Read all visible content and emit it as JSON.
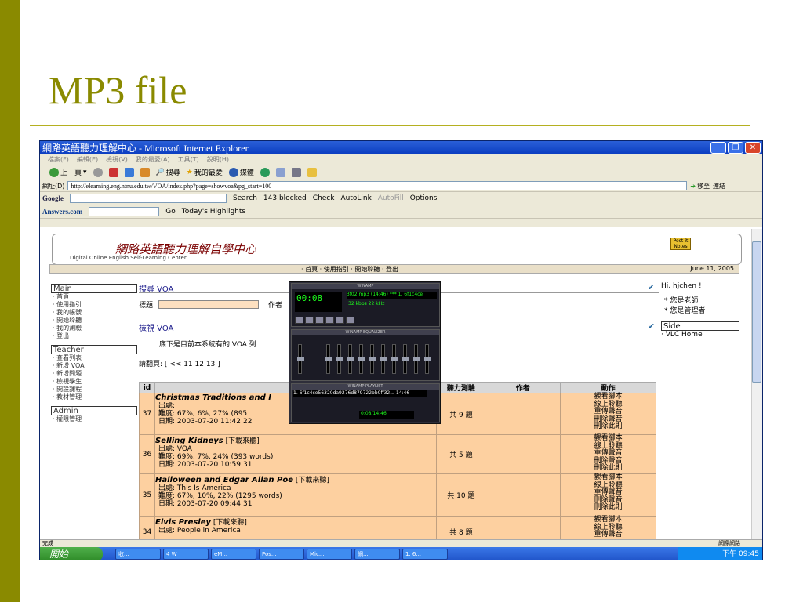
{
  "slide": {
    "title": "MP3 file"
  },
  "browser": {
    "title": "網路英語聽力理解中心 - Microsoft Internet Explorer",
    "menu": [
      "檔案(F)",
      "編輯(E)",
      "檢視(V)",
      "我的最愛(A)",
      "工具(T)",
      "說明(H)"
    ],
    "toolbar": {
      "back": "上一頁",
      "search": "搜尋",
      "favorites": "我的最愛",
      "media": "媒體"
    },
    "address_label": "網址(D)",
    "url": "http://elearning.eng.ntnu.edu.tw/VOA/index.php?page=showvoa&pg_start=100",
    "go": "移至",
    "links": "連結",
    "google": {
      "label": "Google",
      "search": "Search",
      "blocked": "143 blocked",
      "check": "Check",
      "autolink": "AutoLink",
      "autofill": "AutoFill",
      "options": "Options"
    },
    "answers": {
      "label": "Answers.com",
      "go": "Go",
      "highlights": "Today's Highlights"
    },
    "status": "完成",
    "zone": "網際網路"
  },
  "site": {
    "logo_cn": "網路英語聽力理解自學中心",
    "logo_en": "Digital Online English Self-Learning Center",
    "postit": "Post-it Notes",
    "nav": "· 首頁 · 使用指引 · 開始聆聽 · 登出",
    "date": "June 11, 2005",
    "sidebar": {
      "main_title": "Main",
      "main_items": [
        "· 首頁",
        "· 使用指引",
        "· 我的帳號",
        "· 開始聆聽",
        "· 我的測驗",
        "· 登出"
      ],
      "teacher_title": "Teacher",
      "teacher_items": [
        "· 查看列表",
        "· 新增 VOA",
        "· 新增問題",
        "· 檢視學生",
        "· 開設課程",
        "· 教材管理"
      ],
      "admin_title": "Admin",
      "admin_items": [
        "· 權限管理"
      ]
    },
    "search": {
      "title": "搜尋 VOA",
      "keyword_label": "標題:",
      "author_label": "作者"
    },
    "view": {
      "title": "檢視 VOA",
      "desc": "底下是目前本系統有的 VOA 列",
      "pages": "請翻頁: [ << 11 12 13 ]"
    },
    "table": {
      "headers": [
        "id",
        "",
        "聽力測驗",
        "作者",
        "動作"
      ],
      "actions": [
        "觀看腳本",
        "線上聆聽",
        "重傳聲音",
        "刪除聲音",
        "刪除此則"
      ],
      "rows": [
        {
          "id": "37",
          "title": "Christmas Traditions and I",
          "dl": "",
          "src": "出處:",
          "diff": "難度: 67%, 6%, 27% (895",
          "date": "日期: 2003-07-20 11:42:22",
          "quiz": "共 9 題"
        },
        {
          "id": "36",
          "title": "Selling Kidneys",
          "dl": "[下載來聽]",
          "src": "出處: VOA",
          "diff": "難度: 69%, 7%, 24% (393 words)",
          "date": "日期: 2003-07-20 10:59:31",
          "quiz": "共 5 題"
        },
        {
          "id": "35",
          "title": "Halloween and Edgar Allan Poe",
          "dl": "[下載來聽]",
          "src": "出處: This Is America",
          "diff": "難度: 67%, 10%, 22% (1295 words)",
          "date": "日期: 2003-07-20 09:44:31",
          "quiz": "共 10 題"
        },
        {
          "id": "34",
          "title": "Elvis Presley",
          "dl": "[下載來聽]",
          "src": "出處: People in America",
          "diff": "",
          "date": "",
          "quiz": "共 8 題"
        }
      ]
    },
    "right": {
      "greeting": "Hi, hjchen !",
      "lines": [
        "* 您是老師",
        "* 您是管理者"
      ],
      "side_title": "Side",
      "side_items": [
        "· VLC Home"
      ]
    }
  },
  "winamp": {
    "title": "WINAMP",
    "time": "00:08",
    "track": "3f02.mp3 (14:46) *** 1. 6f1c4ce",
    "kbps": "32",
    "khz": "22",
    "eq_title": "WINAMP EQUALIZER",
    "pl_title": "WINAMP PLAYLIST",
    "pl_item": "1. 6f1c4ce56320da9276d879722bb0ff32... 14:46",
    "pl_time": "0:08/14:46"
  },
  "taskbar": {
    "start": "開始",
    "tasks": [
      "收...",
      "4 W",
      "eM...",
      "Pos...",
      "Mic...",
      "網...",
      "1. 6..."
    ],
    "clock": "下午 09:45"
  }
}
